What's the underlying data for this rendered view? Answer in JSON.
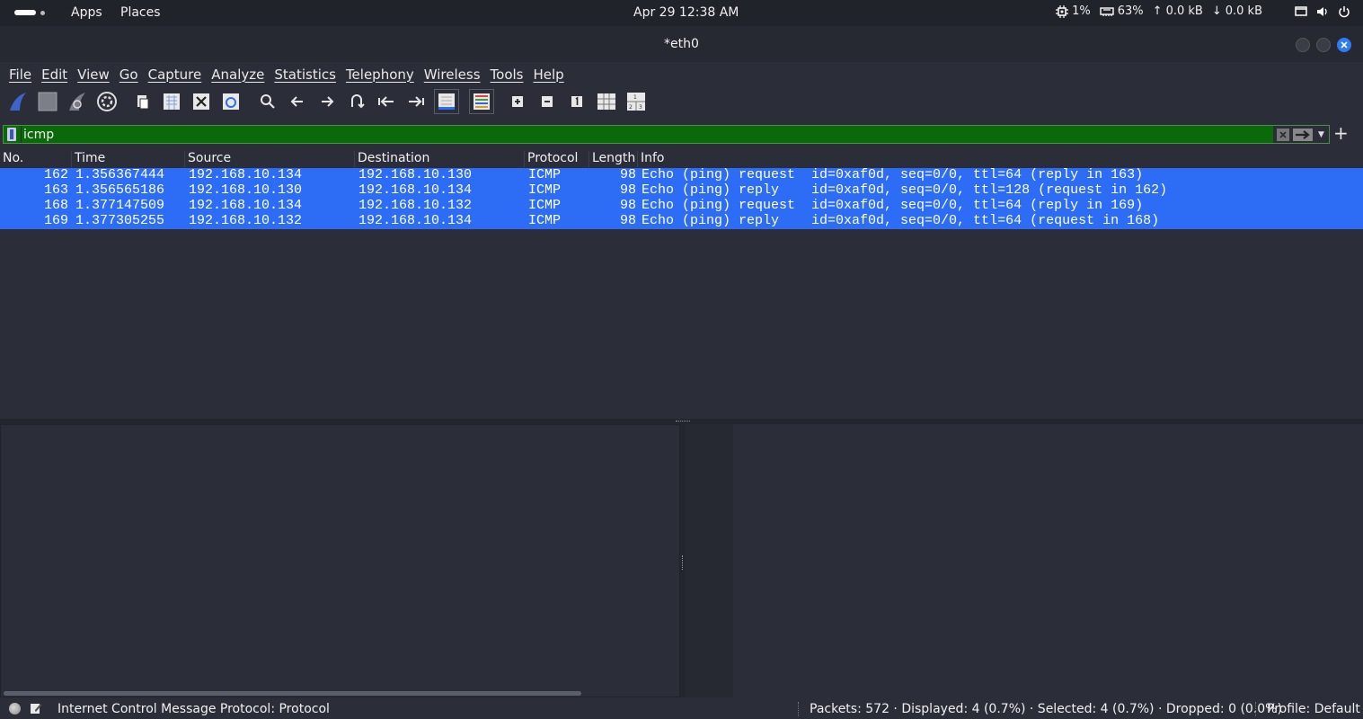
{
  "system_bar": {
    "apps_label": "Apps",
    "places_label": "Places",
    "datetime": "Apr 29  12:38 AM",
    "cpu": "1%",
    "memory": "63%",
    "upload": "0.0 kB",
    "download": "0.0 kB"
  },
  "window": {
    "title": "*eth0"
  },
  "menu": {
    "items": [
      "File",
      "Edit",
      "View",
      "Go",
      "Capture",
      "Analyze",
      "Statistics",
      "Telephony",
      "Wireless",
      "Tools",
      "Help"
    ]
  },
  "toolbar": {
    "icons": [
      "start-capture-icon",
      "stop-capture-icon",
      "restart-capture-icon",
      "capture-options-icon",
      "open-file-icon",
      "save-file-icon",
      "close-file-icon",
      "reload-file-icon",
      "find-packet-icon",
      "go-back-icon",
      "go-forward-icon",
      "go-to-packet-icon",
      "first-packet-icon",
      "last-packet-icon",
      "autoscroll-icon",
      "colorize-icon",
      "zoom-in-icon",
      "zoom-out-icon",
      "normal-size-icon",
      "resize-columns-icon"
    ]
  },
  "filter": {
    "value": "icmp"
  },
  "packet_list": {
    "columns": [
      "No.",
      "Time",
      "Source",
      "Destination",
      "Protocol",
      "Length",
      "Info"
    ],
    "rows": [
      {
        "no": "162",
        "time": "1.356367444",
        "source": "192.168.10.134",
        "destination": "192.168.10.130",
        "protocol": "ICMP",
        "length": "98",
        "info": "Echo (ping) request  id=0xaf0d, seq=0/0, ttl=64 (reply in 163)"
      },
      {
        "no": "163",
        "time": "1.356565186",
        "source": "192.168.10.130",
        "destination": "192.168.10.134",
        "protocol": "ICMP",
        "length": "98",
        "info": "Echo (ping) reply    id=0xaf0d, seq=0/0, ttl=128 (request in 162)"
      },
      {
        "no": "168",
        "time": "1.377147509",
        "source": "192.168.10.134",
        "destination": "192.168.10.132",
        "protocol": "ICMP",
        "length": "98",
        "info": "Echo (ping) request  id=0xaf0d, seq=0/0, ttl=64 (reply in 169)"
      },
      {
        "no": "169",
        "time": "1.377305255",
        "source": "192.168.10.132",
        "destination": "192.168.10.134",
        "protocol": "ICMP",
        "length": "98",
        "info": "Echo (ping) reply    id=0xaf0d, seq=0/0, ttl=64 (request in 168)"
      }
    ]
  },
  "status_bar": {
    "message": "Internet Control Message Protocol: Protocol",
    "stats": "Packets: 572 · Displayed: 4 (0.7%) · Selected: 4 (0.7%) · Dropped: 0 (0.0%)",
    "profile": "Profile: Default"
  },
  "colors": {
    "selection": "#2d6df6",
    "filter_valid": "#0a6a0a",
    "background": "#2b2e38",
    "close_button": "#2d7cf6"
  }
}
